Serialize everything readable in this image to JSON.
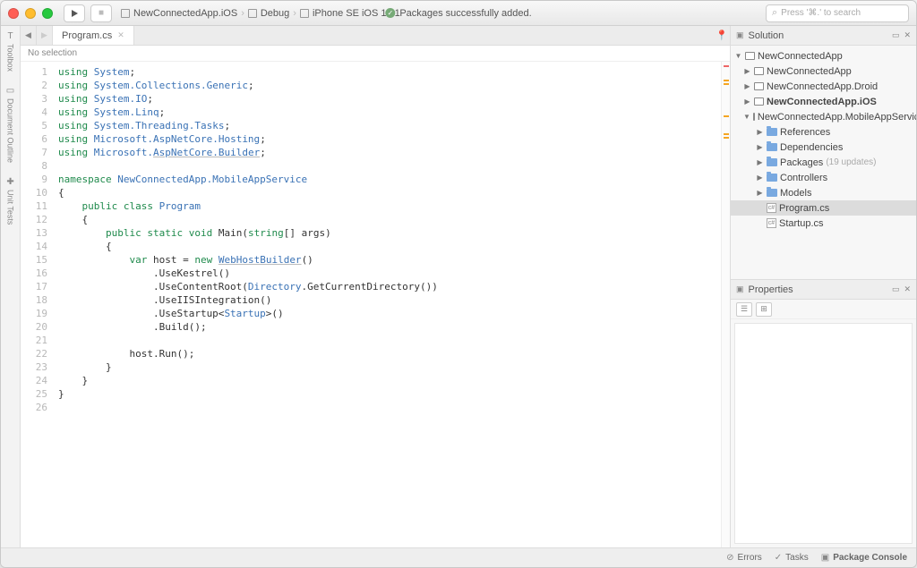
{
  "titlebar": {
    "crumbs": [
      "NewConnectedApp.iOS",
      "Debug",
      "iPhone SE iOS 10.1"
    ],
    "status": "Packages successfully added.",
    "search_placeholder": "Press '⌘.' to search"
  },
  "leftrail": {
    "toolbox": "Toolbox",
    "outline": "Document Outline",
    "tests": "Unit Tests"
  },
  "editor": {
    "tab": "Program.cs",
    "context": "No selection",
    "lines": [
      {
        "n": 1,
        "h": "<span class='kw'>using</span> <span class='ns'>System</span>;"
      },
      {
        "n": 2,
        "h": "<span class='kw'>using</span> <span class='ns'>System.Collections.Generic</span>;"
      },
      {
        "n": 3,
        "h": "<span class='kw'>using</span> <span class='ns'>System.IO</span>;"
      },
      {
        "n": 4,
        "h": "<span class='kw'>using</span> <span class='ns'>System.Linq</span>;"
      },
      {
        "n": 5,
        "h": "<span class='kw'>using</span> <span class='ns'>System.Threading.Tasks</span>;"
      },
      {
        "n": 6,
        "h": "<span class='kw'>using</span> <span class='ns'>Microsoft.AspNetCore.Hosting</span>;"
      },
      {
        "n": 7,
        "h": "<span class='kw'>using</span> <span class='ns'>Microsoft.<span class='und'>AspNetCore.Builder</span></span>;"
      },
      {
        "n": 8,
        "h": ""
      },
      {
        "n": 9,
        "h": "<span class='kw'>namespace</span> <span class='ns'>NewConnectedApp.MobileAppService</span>"
      },
      {
        "n": 10,
        "h": "{"
      },
      {
        "n": 11,
        "h": "    <span class='kw'>public</span> <span class='kw'>class</span> <span class='cls'>Program</span>"
      },
      {
        "n": 12,
        "h": "    {"
      },
      {
        "n": 13,
        "h": "        <span class='kw'>public</span> <span class='kw'>static</span> <span class='kw'>void</span> Main(<span class='kw'>string</span>[] args)"
      },
      {
        "n": 14,
        "h": "        {"
      },
      {
        "n": 15,
        "h": "            <span class='kw'>var</span> host = <span class='kw'>new</span> <span class='cls und'>WebHostBuilder</span>()"
      },
      {
        "n": 16,
        "h": "                .UseKestrel()"
      },
      {
        "n": 17,
        "h": "                .UseContentRoot(<span class='cls'>Directory</span>.GetCurrentDirectory())"
      },
      {
        "n": 18,
        "h": "                .UseIISIntegration()"
      },
      {
        "n": 19,
        "h": "                .UseStartup&lt;<span class='cls'>Startup</span>&gt;()"
      },
      {
        "n": 20,
        "h": "                .Build();"
      },
      {
        "n": 21,
        "h": ""
      },
      {
        "n": 22,
        "h": "            host.Run();"
      },
      {
        "n": 23,
        "h": "        }"
      },
      {
        "n": 24,
        "h": "    }"
      },
      {
        "n": 25,
        "h": "}"
      },
      {
        "n": 26,
        "h": ""
      }
    ]
  },
  "solution": {
    "title": "Solution",
    "root": "NewConnectedApp",
    "projects": [
      {
        "label": "NewConnectedApp",
        "bold": false
      },
      {
        "label": "NewConnectedApp.Droid",
        "bold": false
      },
      {
        "label": "NewConnectedApp.iOS",
        "bold": true
      }
    ],
    "service": {
      "label": "NewConnectedApp.MobileAppService",
      "folders": [
        {
          "label": "References",
          "note": ""
        },
        {
          "label": "Dependencies",
          "note": ""
        },
        {
          "label": "Packages",
          "note": "(19 updates)"
        },
        {
          "label": "Controllers",
          "note": ""
        },
        {
          "label": "Models",
          "note": ""
        }
      ],
      "files": [
        "Program.cs",
        "Startup.cs"
      ],
      "selected": "Program.cs"
    }
  },
  "properties": {
    "title": "Properties"
  },
  "statusbar": {
    "errors": "Errors",
    "tasks": "Tasks",
    "console": "Package Console"
  }
}
